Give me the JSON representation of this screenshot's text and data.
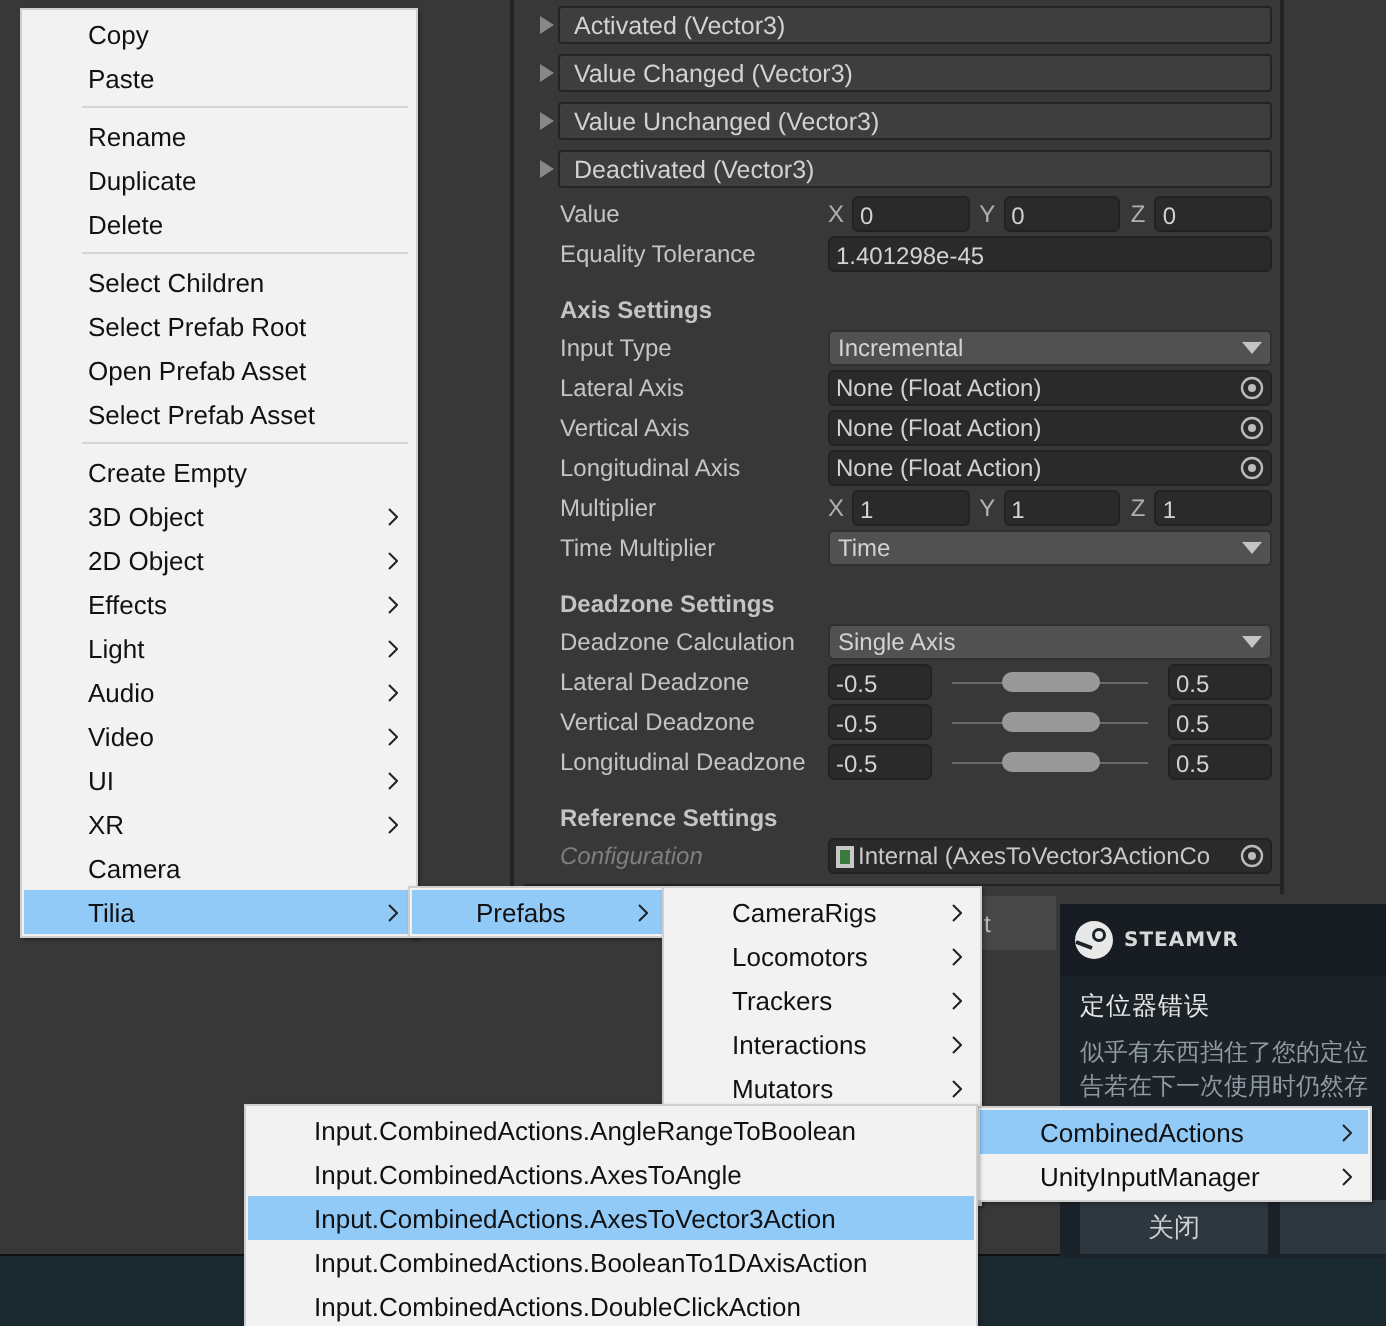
{
  "inspector": {
    "events": [
      {
        "label": "Activated (Vector3)",
        "expanded": false
      },
      {
        "label": "Value Changed (Vector3)",
        "expanded": false
      },
      {
        "label": "Value Unchanged (Vector3)",
        "expanded": false
      },
      {
        "label": "Deactivated (Vector3)",
        "expanded": false
      }
    ],
    "sections": [
      {
        "rows": [
          {
            "kind": "vector3",
            "label": "Value",
            "disabled": false,
            "axes": [
              {
                "axis": "X",
                "value": "0"
              },
              {
                "axis": "Y",
                "value": "0"
              },
              {
                "axis": "Z",
                "value": "0"
              }
            ]
          },
          {
            "kind": "float",
            "label": "Equality Tolerance",
            "disabled": false,
            "value": "1.401298e-45"
          }
        ]
      },
      {
        "heading": "Axis Settings",
        "rows": [
          {
            "kind": "dropdown",
            "label": "Input Type",
            "disabled": false,
            "value": "Incremental"
          },
          {
            "kind": "object",
            "label": "Lateral Axis",
            "disabled": false,
            "value": "None (Float Action)"
          },
          {
            "kind": "object",
            "label": "Vertical Axis",
            "disabled": false,
            "value": "None (Float Action)"
          },
          {
            "kind": "object",
            "label": "Longitudinal Axis",
            "disabled": false,
            "value": "None (Float Action)"
          },
          {
            "kind": "vector3",
            "label": "Multiplier",
            "disabled": false,
            "axes": [
              {
                "axis": "X",
                "value": "1"
              },
              {
                "axis": "Y",
                "value": "1"
              },
              {
                "axis": "Z",
                "value": "1"
              }
            ]
          },
          {
            "kind": "dropdown",
            "label": "Time Multiplier",
            "disabled": false,
            "value": "Time"
          }
        ]
      },
      {
        "heading": "Deadzone Settings",
        "rows": [
          {
            "kind": "dropdown",
            "label": "Deadzone Calculation",
            "disabled": false,
            "value": "Single Axis"
          },
          {
            "kind": "minmax",
            "label": "Lateral Deadzone",
            "disabled": false,
            "min": "-0.5",
            "max": "0.5"
          },
          {
            "kind": "minmax",
            "label": "Vertical Deadzone",
            "disabled": false,
            "min": "-0.5",
            "max": "0.5"
          },
          {
            "kind": "minmax",
            "label": "Longitudinal Deadzone",
            "disabled": false,
            "min": "-0.5",
            "max": "0.5"
          }
        ]
      },
      {
        "heading": "Reference Settings",
        "rows": [
          {
            "kind": "object",
            "label": "Configuration",
            "disabled": true,
            "value": "Internal (AxesToVector3ActionCo"
          }
        ]
      }
    ]
  },
  "toolbar_button": "t",
  "steamvr_dialog": {
    "logo": "STEAMVR",
    "title": "定位器错误",
    "body_lines": [
      "似乎有东西挡住了您的定位",
      "告若在下一次使用时仍然存"
    ],
    "buttons": [
      "关闭"
    ]
  },
  "context_menu": {
    "groups": [
      [
        {
          "label": "Copy",
          "submenu": false,
          "selected": false
        },
        {
          "label": "Paste",
          "submenu": false,
          "selected": false
        }
      ],
      [
        {
          "label": "Rename",
          "submenu": false,
          "selected": false
        },
        {
          "label": "Duplicate",
          "submenu": false,
          "selected": false
        },
        {
          "label": "Delete",
          "submenu": false,
          "selected": false
        }
      ],
      [
        {
          "label": "Select Children",
          "submenu": false,
          "selected": false
        },
        {
          "label": "Select Prefab Root",
          "submenu": false,
          "selected": false
        },
        {
          "label": "Open Prefab Asset",
          "submenu": false,
          "selected": false
        },
        {
          "label": "Select Prefab Asset",
          "submenu": false,
          "selected": false
        }
      ],
      [
        {
          "label": "Create Empty",
          "submenu": false,
          "selected": false
        },
        {
          "label": "3D Object",
          "submenu": true,
          "selected": false
        },
        {
          "label": "2D Object",
          "submenu": true,
          "selected": false
        },
        {
          "label": "Effects",
          "submenu": true,
          "selected": false
        },
        {
          "label": "Light",
          "submenu": true,
          "selected": false
        },
        {
          "label": "Audio",
          "submenu": true,
          "selected": false
        },
        {
          "label": "Video",
          "submenu": true,
          "selected": false
        },
        {
          "label": "UI",
          "submenu": true,
          "selected": false
        },
        {
          "label": "XR",
          "submenu": true,
          "selected": false
        },
        {
          "label": "Camera",
          "submenu": false,
          "selected": false
        },
        {
          "label": "Tilia",
          "submenu": true,
          "selected": true
        }
      ]
    ]
  },
  "tilia_menu": [
    {
      "label": "Prefabs",
      "submenu": true,
      "selected": true
    }
  ],
  "prefabs_menu": [
    {
      "label": "CameraRigs",
      "submenu": true,
      "selected": false
    },
    {
      "label": "Locomotors",
      "submenu": true,
      "selected": false
    },
    {
      "label": "Trackers",
      "submenu": true,
      "selected": false
    },
    {
      "label": "Interactions",
      "submenu": true,
      "selected": false
    },
    {
      "label": "Mutators",
      "submenu": true,
      "selected": false
    }
  ],
  "input_menu": [
    {
      "label": "CombinedActions",
      "submenu": true,
      "selected": true
    },
    {
      "label": "UnityInputManager",
      "submenu": true,
      "selected": false
    }
  ],
  "combined_actions_menu": [
    {
      "label": "Input.CombinedActions.AngleRangeToBoolean",
      "submenu": false,
      "selected": false
    },
    {
      "label": "Input.CombinedActions.AxesToAngle",
      "submenu": false,
      "selected": false
    },
    {
      "label": "Input.CombinedActions.AxesToVector3Action",
      "submenu": false,
      "selected": true
    },
    {
      "label": "Input.CombinedActions.BooleanTo1DAxisAction",
      "submenu": false,
      "selected": false
    },
    {
      "label": "Input.CombinedActions.DoubleClickAction",
      "submenu": false,
      "selected": false
    }
  ]
}
